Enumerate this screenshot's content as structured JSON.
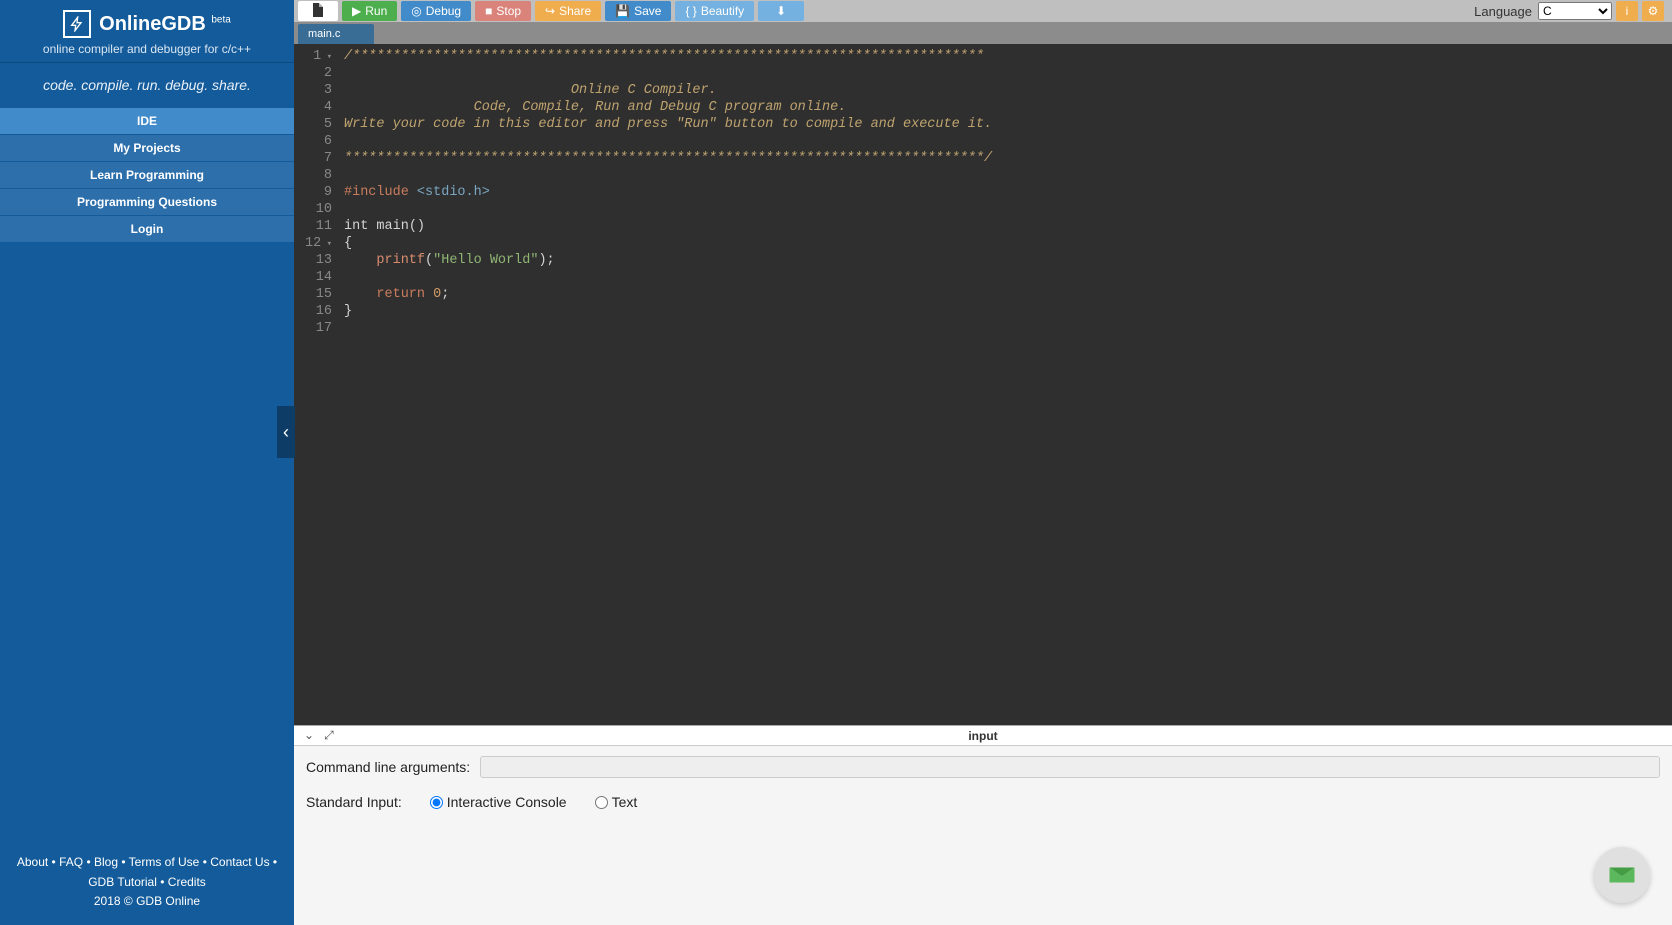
{
  "brand": {
    "name": "OnlineGDB",
    "badge": "beta",
    "subtitle": "online compiler and debugger for c/c++",
    "tagline": "code. compile. run. debug. share."
  },
  "nav": {
    "ide": "IDE",
    "projects": "My Projects",
    "learn": "Learn Programming",
    "questions": "Programming Questions",
    "login": "Login"
  },
  "toolbar": {
    "run": "Run",
    "debug": "Debug",
    "stop": "Stop",
    "share": "Share",
    "save": "Save",
    "beautify": "Beautify",
    "language_label": "Language",
    "language_value": "C"
  },
  "tabs": {
    "main": "main.c"
  },
  "code": {
    "lines": [
      "/******************************************************************************",
      "",
      "                            Online C Compiler.",
      "                Code, Compile, Run and Debug C program online.",
      "Write your code in this editor and press \"Run\" button to compile and execute it.",
      "",
      "*******************************************************************************/",
      "",
      "#include <stdio.h>",
      "",
      "int main()",
      "{",
      "    printf(\"Hello World\");",
      "",
      "    return 0;",
      "}",
      ""
    ]
  },
  "panel": {
    "title": "input",
    "cmd_label": "Command line arguments:",
    "cmd_value": "",
    "stdin_label": "Standard Input:",
    "opt_interactive": "Interactive Console",
    "opt_text": "Text"
  },
  "footer": {
    "about": "About",
    "faq": "FAQ",
    "blog": "Blog",
    "terms": "Terms of Use",
    "contact": "Contact Us",
    "tutorial": "GDB Tutorial",
    "credits": "Credits",
    "copyright": "2018 © GDB Online"
  }
}
